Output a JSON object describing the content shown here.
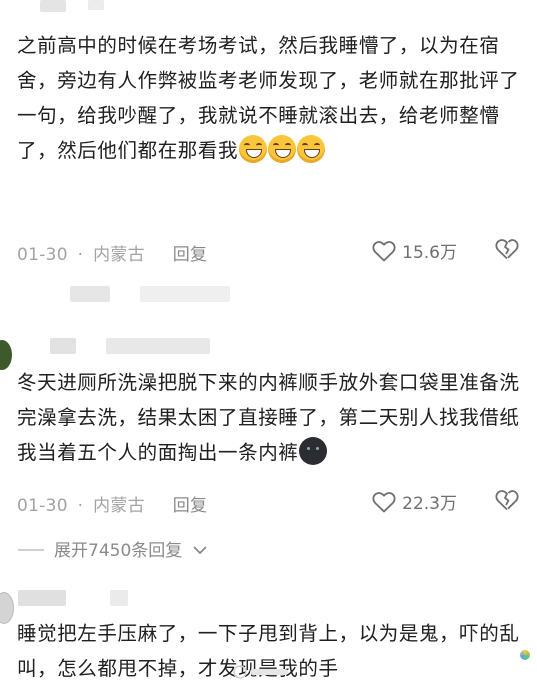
{
  "comments": [
    {
      "text": "之前高中的时候在考场考试，然后我睡懵了，以为在宿舍，旁边有人作弊被监考老师发现了，老师就在那批评了一句，给我吵醒了，我就说不睡就滚出去，给老师整懵了，然后他们都在那看我",
      "date": "01-30",
      "location": "内蒙古",
      "reply_label": "回复",
      "likes": "15.6万"
    },
    {
      "text": "冬天进厕所洗澡把脱下来的内裤顺手放外套口袋里准备洗完澡拿去洗，结果太困了直接睡了，第二天别人找我借纸我当着五个人的面掏出一条内裤",
      "date": "01-30",
      "location": "内蒙古",
      "reply_label": "回复",
      "likes": "22.3万",
      "expand_label": "展开7450条回复"
    },
    {
      "text": "睡觉把左手压麻了，一下子甩到背上，以为是鬼，吓的乱叫，怎么都甩不掉，才发现是我的手"
    }
  ],
  "icons": {
    "like": "heart-outline-icon",
    "dislike": "broken-heart-icon",
    "expand": "chevron-down-icon",
    "emoji_grin": "grinning-face-icon",
    "emoji_dark": "dark-face-icon"
  },
  "colors": {
    "text": "#202020",
    "meta": "#a3a3a3",
    "reply": "#8a8a8a"
  }
}
